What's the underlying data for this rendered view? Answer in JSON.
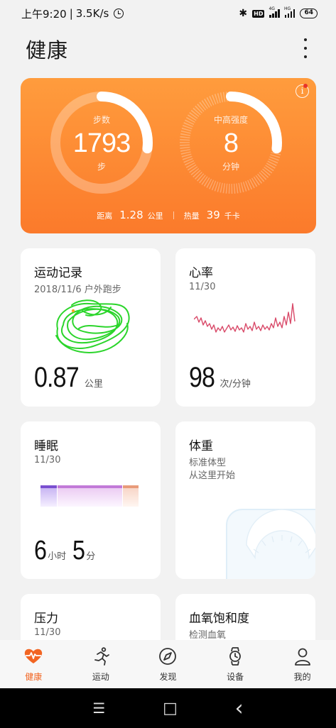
{
  "status_bar": {
    "time": "上午9:20",
    "speed": "3.5K/s",
    "hd": "HD",
    "net1": "4G",
    "net2": "HG",
    "battery": "64"
  },
  "header": {
    "title": "健康"
  },
  "hero": {
    "steps": {
      "label": "步数",
      "value": "1793",
      "unit": "步",
      "progress": 0.27
    },
    "intensity": {
      "label": "中高强度",
      "value": "8",
      "unit": "分钟",
      "progress": 0.27
    },
    "distance_label": "距离",
    "distance_value": "1.28",
    "distance_unit": "公里",
    "calories_label": "热量",
    "calories_value": "39",
    "calories_unit": "千卡"
  },
  "cards": {
    "exercise": {
      "title": "运动记录",
      "subtitle": "2018/11/6 户外跑步",
      "value": "0.87",
      "unit": "公里",
      "route_color": "#2bd52b"
    },
    "heart": {
      "title": "心率",
      "date": "11/30",
      "value": "98",
      "unit": "次/分钟",
      "line_color": "#d94b6a"
    },
    "sleep": {
      "title": "睡眠",
      "date": "11/30",
      "hours": "6",
      "hours_unit": "小时",
      "minutes": "5",
      "minutes_unit": "分"
    },
    "weight": {
      "title": "体重",
      "line1": "标准体型",
      "line2": "从这里开始"
    },
    "stress": {
      "title": "压力",
      "date": "11/30"
    },
    "spo2": {
      "title": "血氧饱和度",
      "subtitle": "检测血氧"
    }
  },
  "bottom_nav": {
    "items": [
      {
        "label": "健康",
        "icon": "heart-pulse-icon",
        "active": true
      },
      {
        "label": "运动",
        "icon": "running-icon",
        "active": false
      },
      {
        "label": "发现",
        "icon": "compass-icon",
        "active": false
      },
      {
        "label": "设备",
        "icon": "watch-icon",
        "active": false
      },
      {
        "label": "我的",
        "icon": "person-icon",
        "active": false
      }
    ],
    "active_color": "#f26522"
  },
  "system_nav": {
    "menu": "☰",
    "home": "□",
    "back": "‹"
  }
}
